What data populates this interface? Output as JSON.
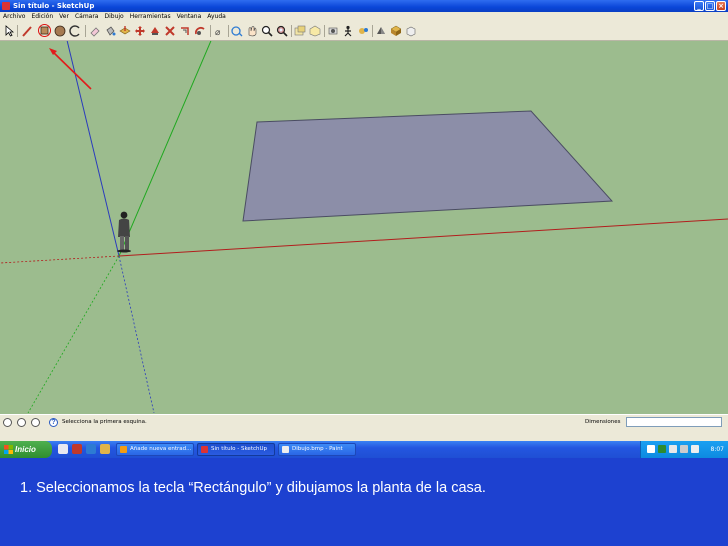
{
  "window": {
    "title": "Sin título - SketchUp"
  },
  "menu": [
    "Archivo",
    "Edición",
    "Ver",
    "Cámara",
    "Dibujo",
    "Herramientas",
    "Ventana",
    "Ayuda"
  ],
  "toolbar": {
    "tools": [
      "select-arrow-icon",
      "pencil-line-icon",
      "rectangle-icon",
      "circle-icon",
      "arc-icon",
      "eraser-icon",
      "paint-bucket-icon",
      "push-pull-icon",
      "move-icon",
      "rotate-icon",
      "follow-me-icon",
      "offset-icon",
      "tape-measure-icon",
      "orbit-icon",
      "pan-hand-icon",
      "zoom-icon",
      "zoom-window-icon",
      "zoom-extents-icon",
      "section-plane-icon",
      "components-icon",
      "position-camera-icon",
      "walk-icon",
      "look-around-icon",
      "shadows-icon",
      "materials-icon"
    ],
    "active_tool": "rectangle-icon"
  },
  "status": {
    "message": "Selecciona la primera esquina.",
    "dimensions_label": "Dimensiones",
    "dimensions_value": ""
  },
  "taskbar": {
    "start_label": "Inicio",
    "tasks": [
      {
        "label": "Añade nueva entrad...",
        "active": false
      },
      {
        "label": "Sin título - SketchUp",
        "active": true
      },
      {
        "label": "Dibujo.bmp - Paint",
        "active": false
      }
    ],
    "clock": "8:07"
  },
  "caption": {
    "text": "1. Seleccionamos la tecla “Rectángulo” y dibujamos la planta de la casa."
  },
  "colors": {
    "viewport_bg": "#9cbc8e",
    "rectangle_face": "#8c8ea8",
    "red_axis": "#b21d1d",
    "green_axis": "#1fa81f",
    "blue_axis": "#2a3bbd",
    "annotation_arrow": "#e21b1b",
    "caption_bg": "#1d41d0"
  }
}
